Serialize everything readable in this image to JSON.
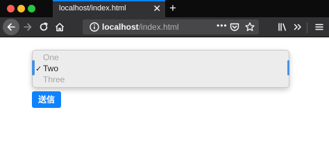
{
  "window": {
    "controls": [
      "close",
      "minimize",
      "zoom"
    ]
  },
  "tab": {
    "title": "localhost/index.html",
    "close_glyph": "✕",
    "accent": "#0a84ff"
  },
  "new_tab_glyph": "+",
  "toolbar": {
    "icons": [
      "back-arrow-icon",
      "forward-arrow-icon",
      "reload-icon",
      "home-icon",
      "info-icon",
      "page-actions-icon",
      "pocket-icon",
      "bookmark-star-icon",
      "library-icon",
      "overflow-chevron-icon",
      "hamburger-menu-icon"
    ],
    "more_label": "•••"
  },
  "url": {
    "host": "localhost",
    "path": "/index.html"
  },
  "select": {
    "options": [
      {
        "label": "One",
        "selected": false
      },
      {
        "label": "Two",
        "selected": true
      },
      {
        "label": "Three",
        "selected": false
      }
    ],
    "check_glyph": "✓"
  },
  "submit": {
    "label": "送信",
    "color": "#0f83fd"
  }
}
